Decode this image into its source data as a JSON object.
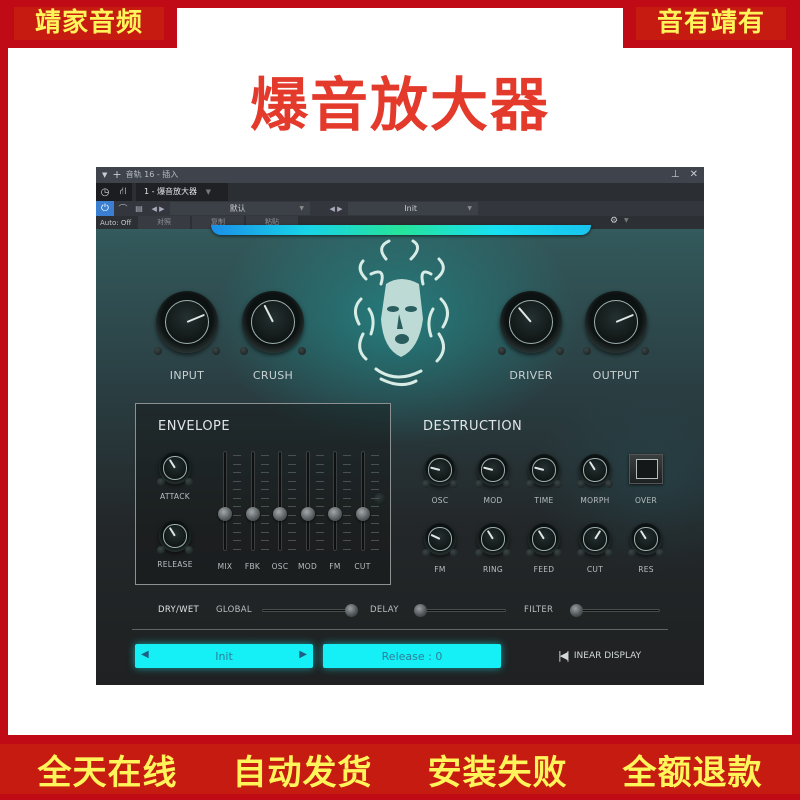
{
  "banner": {
    "top_left": "靖家音频",
    "top_right": "音有靖有",
    "title": "爆音放大器",
    "bottom": [
      "全天在线",
      "自动发货",
      "安装失败",
      "全额退款"
    ],
    "colors": {
      "frame": "#c00a16",
      "badge_text": "#fff45a",
      "title": "#e33a2c"
    }
  },
  "host": {
    "titlebar": "音轨 16 - 插入",
    "tab_label": "1 - 爆音放大器",
    "preset_bank": "默认",
    "preset_name": "Init",
    "auto_label": "Auto: Off",
    "buttons": [
      "对照",
      "复制",
      "粘贴"
    ],
    "icons": [
      "collapse-triangle-icon",
      "add-icon",
      "pin-icon",
      "close-icon",
      "power-icon",
      "routing-icon",
      "bypass-arc-icon",
      "document-icon",
      "gear-icon"
    ]
  },
  "plugin": {
    "main_knobs": [
      {
        "label": "INPUT",
        "value": 0.75
      },
      {
        "label": "CRUSH",
        "value": 0.4
      },
      {
        "label": "DRIVER",
        "value": 0.35
      },
      {
        "label": "OUTPUT",
        "value": 0.75
      }
    ],
    "envelope": {
      "title": "ENVELOPE",
      "knobs": [
        {
          "label": "ATTACK",
          "value": 0.38
        },
        {
          "label": "RELEASE",
          "value": 0.38
        }
      ],
      "faders": [
        {
          "label": "MIX",
          "value": 0.5
        },
        {
          "label": "FBK",
          "value": 0.5
        },
        {
          "label": "OSC",
          "value": 0.5
        },
        {
          "label": "MOD",
          "value": 0.5
        },
        {
          "label": "FM",
          "value": 0.5
        },
        {
          "label": "CUT",
          "value": 0.5
        }
      ]
    },
    "destruction": {
      "title": "DESTRUCTION",
      "row1": [
        {
          "label": "OSC",
          "value": 0.22
        },
        {
          "label": "MOD",
          "value": 0.22
        },
        {
          "label": "TIME",
          "value": 0.22
        },
        {
          "label": "MORPH",
          "value": 0.38
        }
      ],
      "over_label": "OVER",
      "row2": [
        {
          "label": "FM",
          "value": 0.26
        },
        {
          "label": "RING",
          "value": 0.38
        },
        {
          "label": "FEED",
          "value": 0.38
        },
        {
          "label": "CUT",
          "value": 0.62
        },
        {
          "label": "RES",
          "value": 0.38
        }
      ]
    },
    "drywet": {
      "label": "DRY/WET",
      "sliders": [
        {
          "label": "GLOBAL",
          "value": 1.0
        },
        {
          "label": "DELAY",
          "value": 0.0
        },
        {
          "label": "FILTER",
          "value": 0.0
        }
      ]
    },
    "preset_display": "Init",
    "release_display": "Release : 0",
    "linear_display": "INEAR DISPLAY",
    "accent": "#14f0f5"
  }
}
